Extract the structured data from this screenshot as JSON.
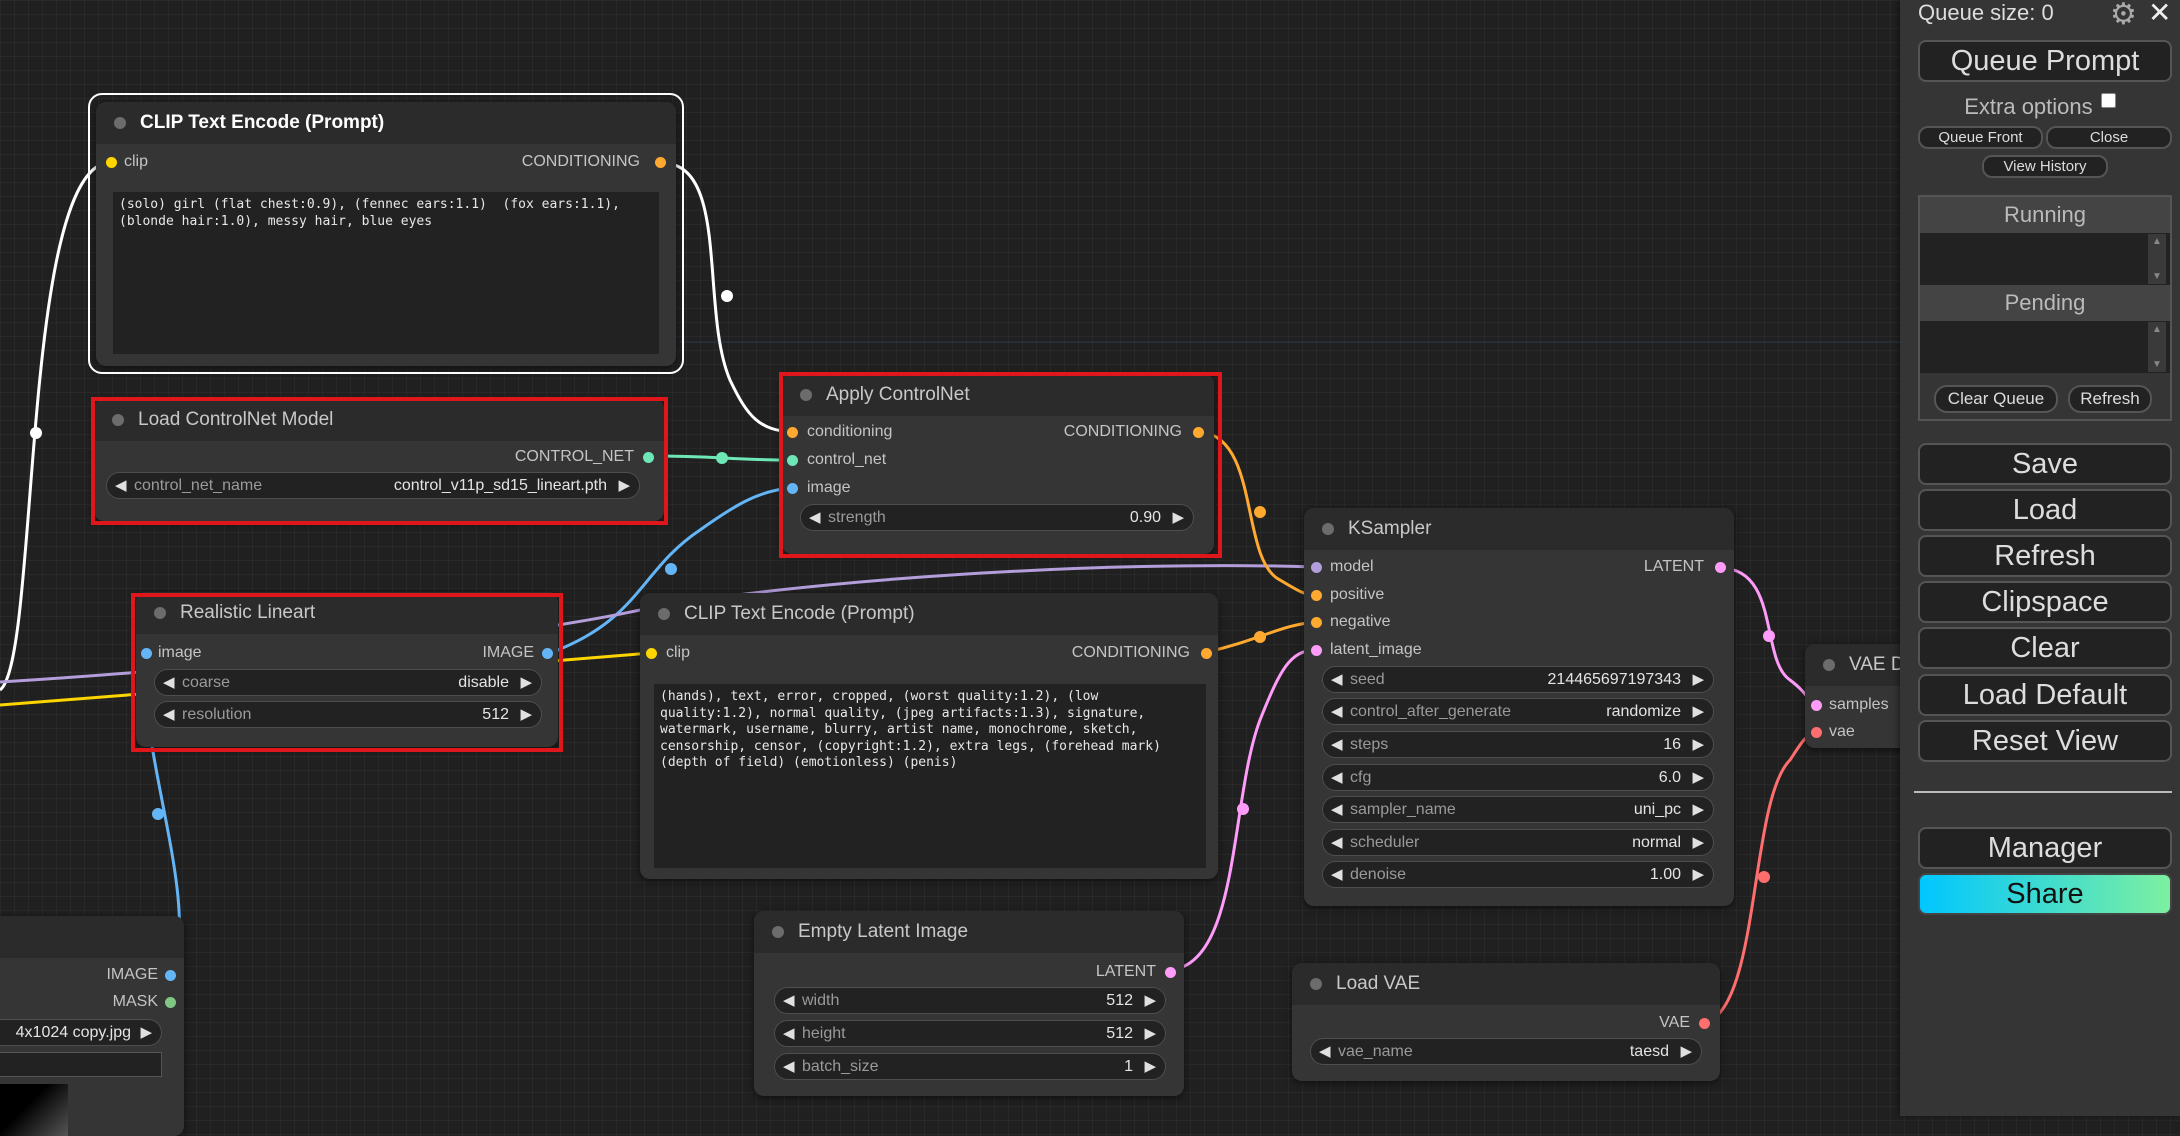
{
  "colors": {
    "clip": "#ffd500",
    "conditioning": "#ffa931",
    "control_net": "#6ee7b7",
    "image": "#64b5f6",
    "model": "#b39ddb",
    "latent": "#ff9cf9",
    "vae": "#ff6e6e",
    "mask": "#81c784",
    "highlight": "#e0161d",
    "share_gradient_start": "#00c6ff",
    "share_gradient_end": "#7df0a0"
  },
  "nodes": {
    "clip_text_top": {
      "title": "CLIP Text Encode (Prompt)",
      "in_clip": "clip",
      "out_conditioning": "CONDITIONING",
      "text": "(solo) girl (flat chest:0.9), (fennec ears:1.1)  (fox ears:1.1), (blonde hair:1.0), messy hair, blue eyes"
    },
    "load_controlnet": {
      "title": "Load ControlNet Model",
      "out_control_net": "CONTROL_NET",
      "w_name": "control_net_name",
      "w_value": "control_v11p_sd15_lineart.pth"
    },
    "apply_controlnet": {
      "title": "Apply ControlNet",
      "in_conditioning": "conditioning",
      "in_control_net": "control_net",
      "in_image": "image",
      "out_conditioning": "CONDITIONING",
      "w_name": "strength",
      "w_value": "0.90"
    },
    "realistic_lineart": {
      "title": "Realistic Lineart",
      "in_image": "image",
      "out_image": "IMAGE",
      "w1_name": "coarse",
      "w1_value": "disable",
      "w2_name": "resolution",
      "w2_value": "512"
    },
    "clip_text_neg": {
      "title": "CLIP Text Encode (Prompt)",
      "in_clip": "clip",
      "out_conditioning": "CONDITIONING",
      "text": "(hands), text, error, cropped, (worst quality:1.2), (low quality:1.2), normal quality, (jpeg artifacts:1.3), signature, watermark, username, blurry, artist name, monochrome, sketch, censorship, censor, (copyright:1.2), extra legs, (forehead mark) (depth of field) (emotionless) (penis)"
    },
    "ksampler": {
      "title": "KSampler",
      "in_model": "model",
      "in_positive": "positive",
      "in_negative": "negative",
      "in_latent": "latent_image",
      "out_latent": "LATENT",
      "widgets": [
        {
          "name": "seed",
          "value": "214465697197343"
        },
        {
          "name": "control_after_generate",
          "value": "randomize"
        },
        {
          "name": "steps",
          "value": "16"
        },
        {
          "name": "cfg",
          "value": "6.0"
        },
        {
          "name": "sampler_name",
          "value": "uni_pc"
        },
        {
          "name": "scheduler",
          "value": "normal"
        },
        {
          "name": "denoise",
          "value": "1.00"
        }
      ]
    },
    "empty_latent": {
      "title": "Empty Latent Image",
      "out_latent": "LATENT",
      "widgets": [
        {
          "name": "width",
          "value": "512"
        },
        {
          "name": "height",
          "value": "512"
        },
        {
          "name": "batch_size",
          "value": "1"
        }
      ]
    },
    "load_vae": {
      "title": "Load VAE",
      "out_vae": "VAE",
      "w_name": "vae_name",
      "w_value": "taesd"
    },
    "vae_decode": {
      "title": "VAE D",
      "in_samples": "samples",
      "in_vae": "vae"
    },
    "load_image": {
      "out_image": "IMAGE",
      "out_mask": "MASK",
      "w_value": "4x1024 copy.jpg"
    }
  },
  "panel": {
    "queue_size": "Queue size: 0",
    "queue_prompt": "Queue Prompt",
    "extra_options": "Extra options",
    "queue_front": "Queue Front",
    "close": "Close",
    "view_history": "View History",
    "running": "Running",
    "pending": "Pending",
    "clear_queue": "Clear Queue",
    "refresh_small": "Refresh",
    "save": "Save",
    "load": "Load",
    "refresh": "Refresh",
    "clipspace": "Clipspace",
    "clear": "Clear",
    "load_default": "Load Default",
    "reset_view": "Reset View",
    "manager": "Manager",
    "share": "Share"
  }
}
